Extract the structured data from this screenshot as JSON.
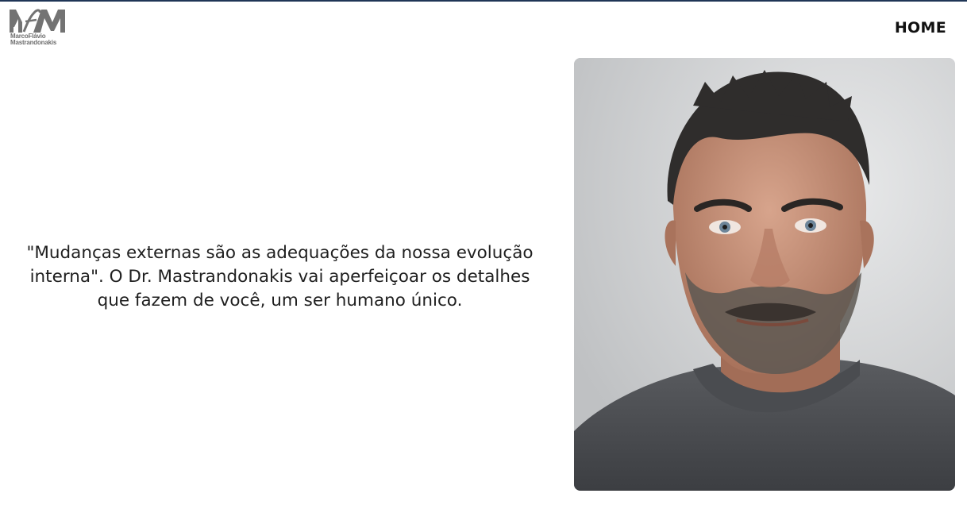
{
  "header": {
    "logo_line1": "MarcoFlávio",
    "logo_line2": "Mastrandonakis",
    "logo_mark_text": "MfM"
  },
  "nav": {
    "home_label": "HOME"
  },
  "main": {
    "quote": "\"Mudanças externas são as adequações da nossa evolução interna\". O Dr. Mastrandonakis vai aperfeiçoar os detalhes que fazem de você, um ser humano único."
  },
  "colors": {
    "top_border": "#1f3556",
    "logo_gray": "#6f6f6f",
    "text": "#1f1f1f"
  }
}
